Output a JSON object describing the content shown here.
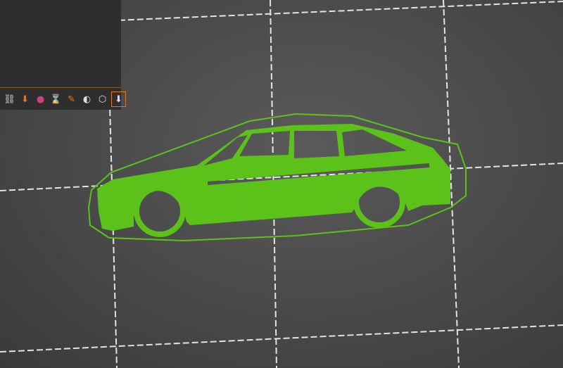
{
  "viewport": {
    "background": "#4a4a4a",
    "grid_color": "#ffffff",
    "model_color": "#5cc21a",
    "skirt_color": "#5cc21a"
  },
  "toolbar": {
    "accent": "#e07a20",
    "items": [
      {
        "icon": "seam-painting-icon",
        "glyph": "⛓"
      },
      {
        "icon": "support-painting-icon",
        "glyph": "⬇"
      },
      {
        "icon": "multimaterial-painting-icon",
        "glyph": "●"
      },
      {
        "icon": "variable-layer-height-icon",
        "glyph": "⌛"
      },
      {
        "icon": "fdm-supports-icon",
        "glyph": "✎"
      },
      {
        "icon": "cut-icon",
        "glyph": "◐"
      },
      {
        "icon": "wireframe-cube-icon",
        "glyph": "⬡"
      },
      {
        "icon": "place-on-face-icon",
        "glyph": "⬇"
      }
    ]
  }
}
